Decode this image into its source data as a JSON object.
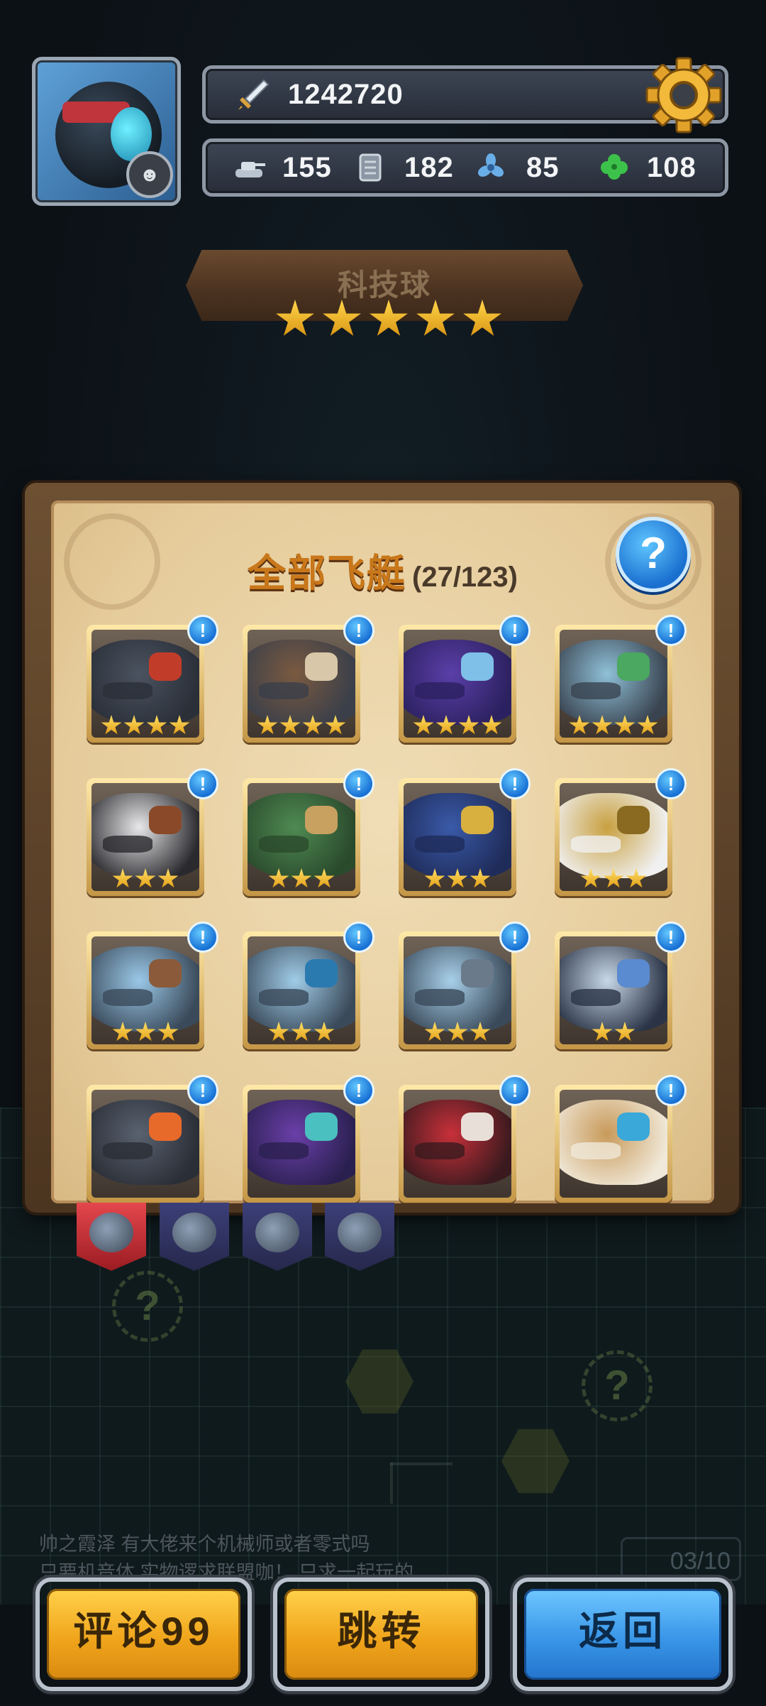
{
  "header": {
    "power": "1242720",
    "resources": [
      {
        "icon": "tank-icon",
        "value": "155"
      },
      {
        "icon": "scroll-icon",
        "value": "182"
      },
      {
        "icon": "fan-icon",
        "value": "85"
      },
      {
        "icon": "clover-icon",
        "value": "108"
      }
    ]
  },
  "character": {
    "name": "科技球",
    "stars": 5
  },
  "modal": {
    "title": "全部飞艇",
    "count": "(27/123)",
    "help_label": "?",
    "alert_label": "!",
    "ships": [
      {
        "stars": 4,
        "colors": [
          "#4b5360",
          "#2a2f38",
          "#c23c2a"
        ]
      },
      {
        "stars": 4,
        "colors": [
          "#7a5a40",
          "#3a3f4a",
          "#d8c7a8"
        ]
      },
      {
        "stars": 4,
        "colors": [
          "#5a3fa8",
          "#2c2160",
          "#7fc0e8"
        ]
      },
      {
        "stars": 4,
        "colors": [
          "#8fc0d8",
          "#3a4450",
          "#4aa860"
        ]
      },
      {
        "stars": 3,
        "colors": [
          "#e8e8ea",
          "#2a2a2e",
          "#8a4a2a"
        ]
      },
      {
        "stars": 3,
        "colors": [
          "#4f8a52",
          "#2a4a2c",
          "#c8a060"
        ]
      },
      {
        "stars": 3,
        "colors": [
          "#3a5aa8",
          "#1f2c5a",
          "#d8b040"
        ]
      },
      {
        "stars": 3,
        "colors": [
          "#c8a040",
          "#f0f0f0",
          "#8a6a20"
        ]
      },
      {
        "stars": 3,
        "colors": [
          "#9ac8e8",
          "#3a4a5a",
          "#8a5a3a"
        ]
      },
      {
        "stars": 3,
        "colors": [
          "#a0cce8",
          "#3a4a5a",
          "#2a7ab0"
        ]
      },
      {
        "stars": 3,
        "colors": [
          "#a8d0ea",
          "#3a4a5a",
          "#6a7a8a"
        ]
      },
      {
        "stars": 2,
        "colors": [
          "#c8d8e8",
          "#2a3446",
          "#5a8ad0"
        ]
      },
      {
        "stars": 0,
        "colors": [
          "#5a6270",
          "#2a2e36",
          "#e86a2a"
        ]
      },
      {
        "stars": 0,
        "colors": [
          "#6a3fa8",
          "#2a2050",
          "#4ac0c0"
        ]
      },
      {
        "stars": 0,
        "colors": [
          "#c8303a",
          "#3a1a1e",
          "#e8e0d8"
        ]
      },
      {
        "stars": 0,
        "colors": [
          "#c89a5a",
          "#f0e8d8",
          "#3aa8d8"
        ]
      }
    ]
  },
  "tabs": [
    {
      "active": true
    },
    {
      "active": false
    },
    {
      "active": false
    },
    {
      "active": false
    }
  ],
  "chat": {
    "line1": "帅之霞泽  有大佬来个机械师或者零式吗",
    "line2": "只要机音体  实物逻求联盟咖！  只求一起玩的"
  },
  "counter": "03/10",
  "buttons": {
    "comment": "评论99",
    "jump": "跳转",
    "back": "返回"
  },
  "colors": {
    "gold": "#f0a51c",
    "blue": "#3996e8",
    "star": "#ffd54a"
  }
}
